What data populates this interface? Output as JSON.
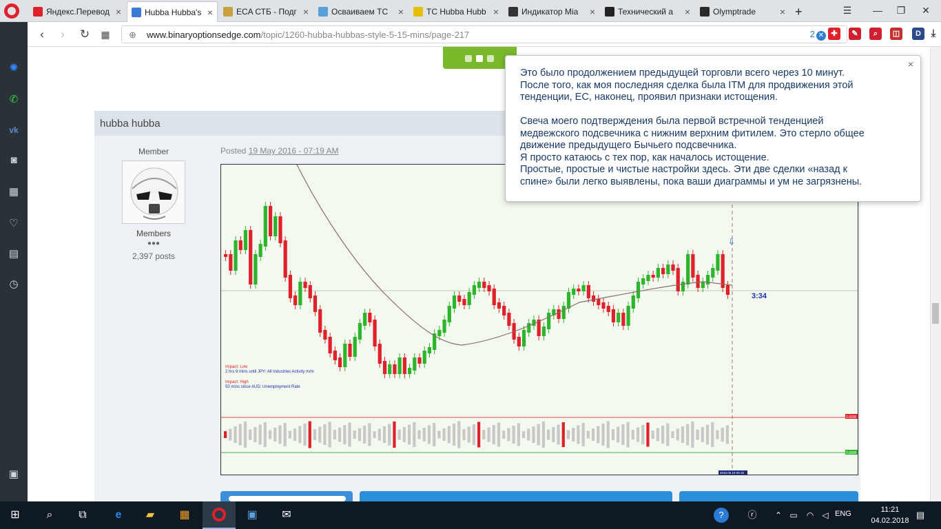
{
  "browser": {
    "tabs": [
      {
        "title": "Яндекс.Перевод",
        "favicon_color": "#e0202b",
        "active": false
      },
      {
        "title": "Hubba Hubba's",
        "favicon_color": "#3a7bd5",
        "active": true
      },
      {
        "title": "ECA СТБ - Подг",
        "favicon_color": "#c8a040",
        "active": false
      },
      {
        "title": "Осваиваем ТС",
        "favicon_color": "#5aa0d8",
        "active": false
      },
      {
        "title": "ТС Hubba Hubb",
        "favicon_color": "#e6c000",
        "active": false
      },
      {
        "title": "Индикатор Mia",
        "favicon_color": "#333333",
        "active": false
      },
      {
        "title": "Технический а",
        "favicon_color": "#222222",
        "active": false
      },
      {
        "title": "Olymptrade",
        "favicon_color": "#2a2a2a",
        "active": false
      }
    ],
    "new_tab": "+",
    "url_host": "www.binaryoptionsedge.com",
    "url_path": "/topic/1260-hubba-hubbas-style-5-15-mins/page-217",
    "translate_badge": "2"
  },
  "post": {
    "header": "hubba hubba",
    "author_role": "Member",
    "author_group": "Members",
    "pips": "●●●",
    "posts": "2,397 posts",
    "posted_prefix": "Posted",
    "posted_date": "19 May 2016 - 07:19 AM"
  },
  "chart": {
    "impact1": "Impact: Low",
    "impact1_detail": "2 hrs 9 mins until JPY: All Industries Activity m/m",
    "impact2": "Impact: High",
    "impact2_detail": "50 mins since AUD: Unemployment Rate",
    "timer": "3:34",
    "level_top": "0.0000",
    "level_bottom": "0.0000",
    "date_label": "2016.05.19 05:15",
    "colors": {
      "up": "#2db52d",
      "down": "#e0202b",
      "ma": "#8a6a6a",
      "bg": "#f3f9ee"
    }
  },
  "popup": {
    "close": "×",
    "para1": "Это было продолжением предыдущей торговли всего через 10 минут.\nПосле того, как моя последняя сделка была ITM для продвижения этой\nтенденции, EC, наконец, проявил признаки истощения.",
    "para2": "Свеча моего подтверждения была первой встречной тенденцией\nмедвежского подсвечника с нижним верхним фитилем. Это стерло общее\nдвижение предыдущего Бычьего подсвечника.\nЯ просто катаюсь с тех пор, как началось истощение.\nПростые, простые и чистые настройки здесь. Эти две сделки «назад к\nспине» были легко выявлены, пока ваши диаграммы и ум не загрязнены."
  },
  "taskbar": {
    "lang": "ENG",
    "time": "11:21",
    "date": "04.02.2018"
  }
}
